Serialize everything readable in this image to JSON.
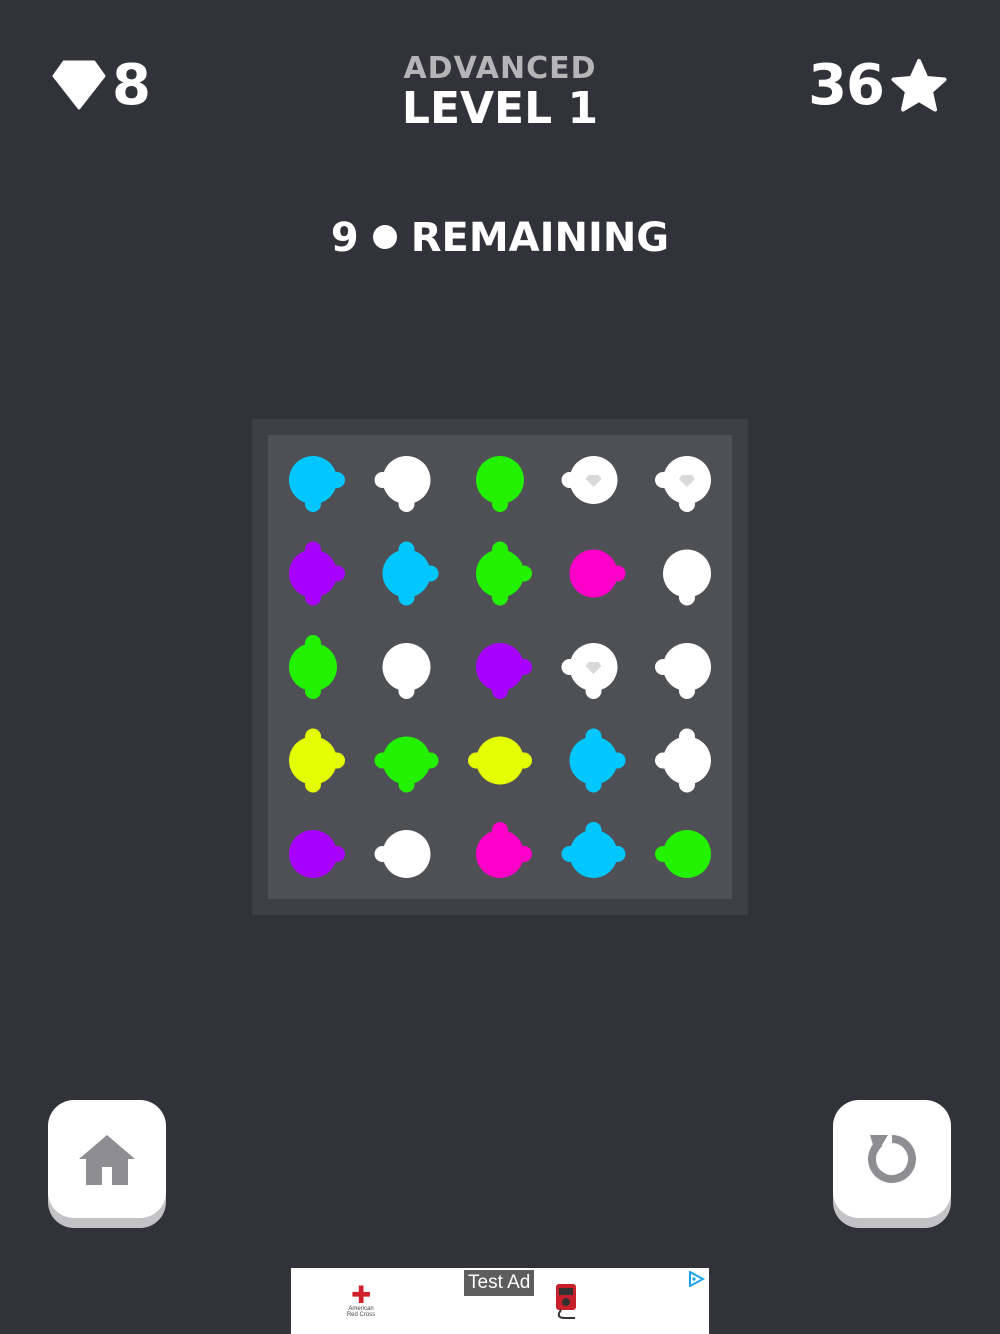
{
  "hud": {
    "gems": "8",
    "stars": "36",
    "mode": "ADVANCED",
    "level": "LEVEL 1"
  },
  "status": {
    "remaining_count": "9",
    "remaining_label": "REMAINING"
  },
  "colors": {
    "background": "#32333a",
    "board_frame": "#3f4046",
    "board": "#4f5056",
    "cyan": "#00c8ff",
    "white": "#ffffff",
    "green": "#22f200",
    "magenta": "#ff00c8",
    "purple": "#a800ff",
    "yellow": "#e4ff00"
  },
  "board": [
    [
      {
        "c": "cyan",
        "n": [
          "R",
          "D"
        ]
      },
      {
        "c": "white",
        "n": [
          "L",
          "D"
        ]
      },
      {
        "c": "green",
        "n": [
          "D"
        ]
      },
      {
        "c": "white",
        "n": [
          "L"
        ],
        "gem": true
      },
      {
        "c": "white",
        "n": [
          "L",
          "D"
        ],
        "gem": true
      }
    ],
    [
      {
        "c": "purple",
        "n": [
          "U",
          "R",
          "D"
        ]
      },
      {
        "c": "cyan",
        "n": [
          "U",
          "R",
          "D"
        ]
      },
      {
        "c": "green",
        "n": [
          "U",
          "R",
          "D"
        ]
      },
      {
        "c": "magenta",
        "n": [
          "R"
        ]
      },
      {
        "c": "white",
        "n": [
          "D"
        ]
      }
    ],
    [
      {
        "c": "green",
        "n": [
          "U",
          "D"
        ]
      },
      {
        "c": "white",
        "n": [
          "D"
        ]
      },
      {
        "c": "purple",
        "n": [
          "R",
          "D"
        ]
      },
      {
        "c": "white",
        "n": [
          "L",
          "D"
        ],
        "gem": true
      },
      {
        "c": "white",
        "n": [
          "L",
          "D"
        ]
      }
    ],
    [
      {
        "c": "yellow",
        "n": [
          "U",
          "R",
          "D"
        ]
      },
      {
        "c": "green",
        "n": [
          "L",
          "R",
          "D"
        ]
      },
      {
        "c": "yellow",
        "n": [
          "L",
          "R"
        ]
      },
      {
        "c": "cyan",
        "n": [
          "U",
          "R",
          "D"
        ]
      },
      {
        "c": "white",
        "n": [
          "U",
          "L",
          "D"
        ]
      }
    ],
    [
      {
        "c": "purple",
        "n": [
          "R"
        ]
      },
      {
        "c": "white",
        "n": [
          "L"
        ]
      },
      {
        "c": "magenta",
        "n": [
          "U",
          "R"
        ]
      },
      {
        "c": "cyan",
        "n": [
          "U",
          "L",
          "R"
        ]
      },
      {
        "c": "green",
        "n": [
          "L"
        ]
      }
    ]
  ],
  "ad": {
    "label": "Test Ad",
    "advertiser": "American Red Cross"
  }
}
